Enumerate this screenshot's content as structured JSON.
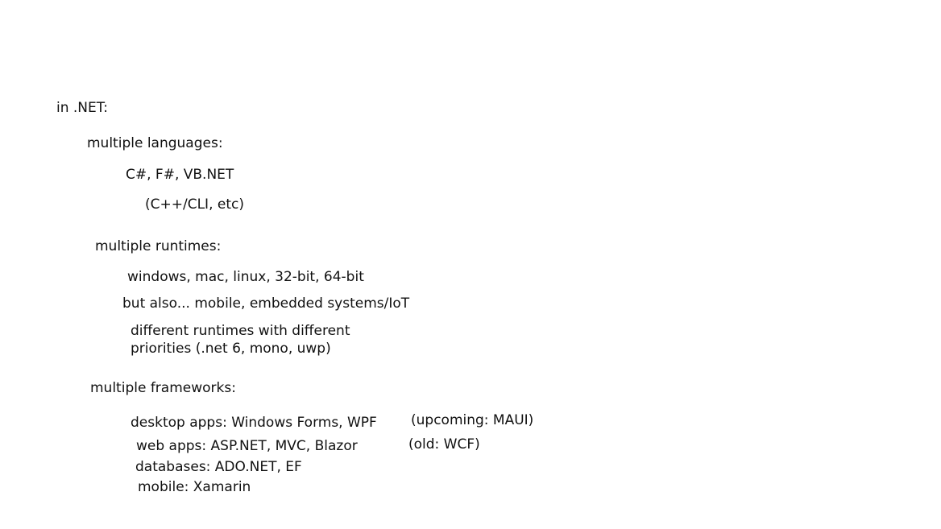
{
  "notes": {
    "heading": "in .NET:",
    "languages": {
      "label": "multiple languages:",
      "main": "C#, F#, VB.NET",
      "others": "(C++/CLI, etc)"
    },
    "runtimes": {
      "label": "multiple runtimes:",
      "platforms": "windows, mac, linux, 32-bit, 64-bit",
      "also": "but also... mobile, embedded systems/IoT",
      "priorities_line1": "different runtimes with different",
      "priorities_line2": "priorities (.net 6, mono, uwp)"
    },
    "frameworks": {
      "label": "multiple frameworks:",
      "desktop": "desktop apps: Windows Forms, WPF",
      "desktop_note": "(upcoming: MAUI)",
      "web": "web apps: ASP.NET, MVC, Blazor",
      "web_note": "(old: WCF)",
      "databases": "databases: ADO.NET, EF",
      "mobile": "mobile: Xamarin"
    }
  }
}
